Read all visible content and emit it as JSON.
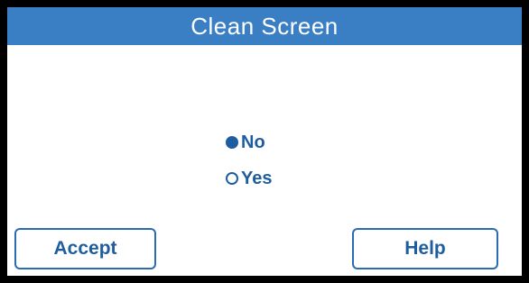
{
  "window": {
    "title": "Clean Screen"
  },
  "options": [
    {
      "label": "No",
      "selected": true
    },
    {
      "label": "Yes",
      "selected": false
    }
  ],
  "buttons": {
    "accept_label": "Accept",
    "help_label": "Help"
  },
  "colors": {
    "title_bar": "#3a7fc4",
    "accent": "#1f5e9e",
    "background": "#ffffff",
    "frame": "#000000"
  }
}
